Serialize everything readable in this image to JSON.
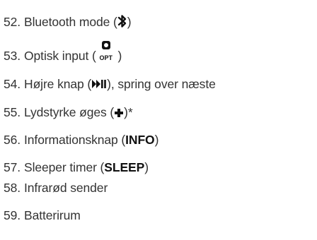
{
  "items": [
    {
      "num": "52.",
      "text_before": "Bluetooth mode (",
      "icon": "bluetooth-icon",
      "text_after": ")"
    },
    {
      "num": "53.",
      "text_before": "Optisk input (",
      "icon": "optical-input-icon",
      "icon_label": "OPT",
      "text_after": " )"
    },
    {
      "num": "54.",
      "text_before": "Højre knap (",
      "icon": "play-pause-skip-icon",
      "text_after": "), spring over næste"
    },
    {
      "num": "55.",
      "text_before": "Lydstyrke øges (",
      "icon": "plus-icon",
      "text_after": ")*"
    },
    {
      "num": "56.",
      "text_before": "Informationsknap (",
      "bold": "INFO",
      "text_after": ")"
    },
    {
      "num": "57.",
      "text_before": "Sleeper timer (",
      "bold": "SLEEP",
      "text_after": ")"
    },
    {
      "num": "58.",
      "text_before": "Infrarød sender"
    },
    {
      "num": "59.",
      "text_before": "Batterirum"
    }
  ]
}
